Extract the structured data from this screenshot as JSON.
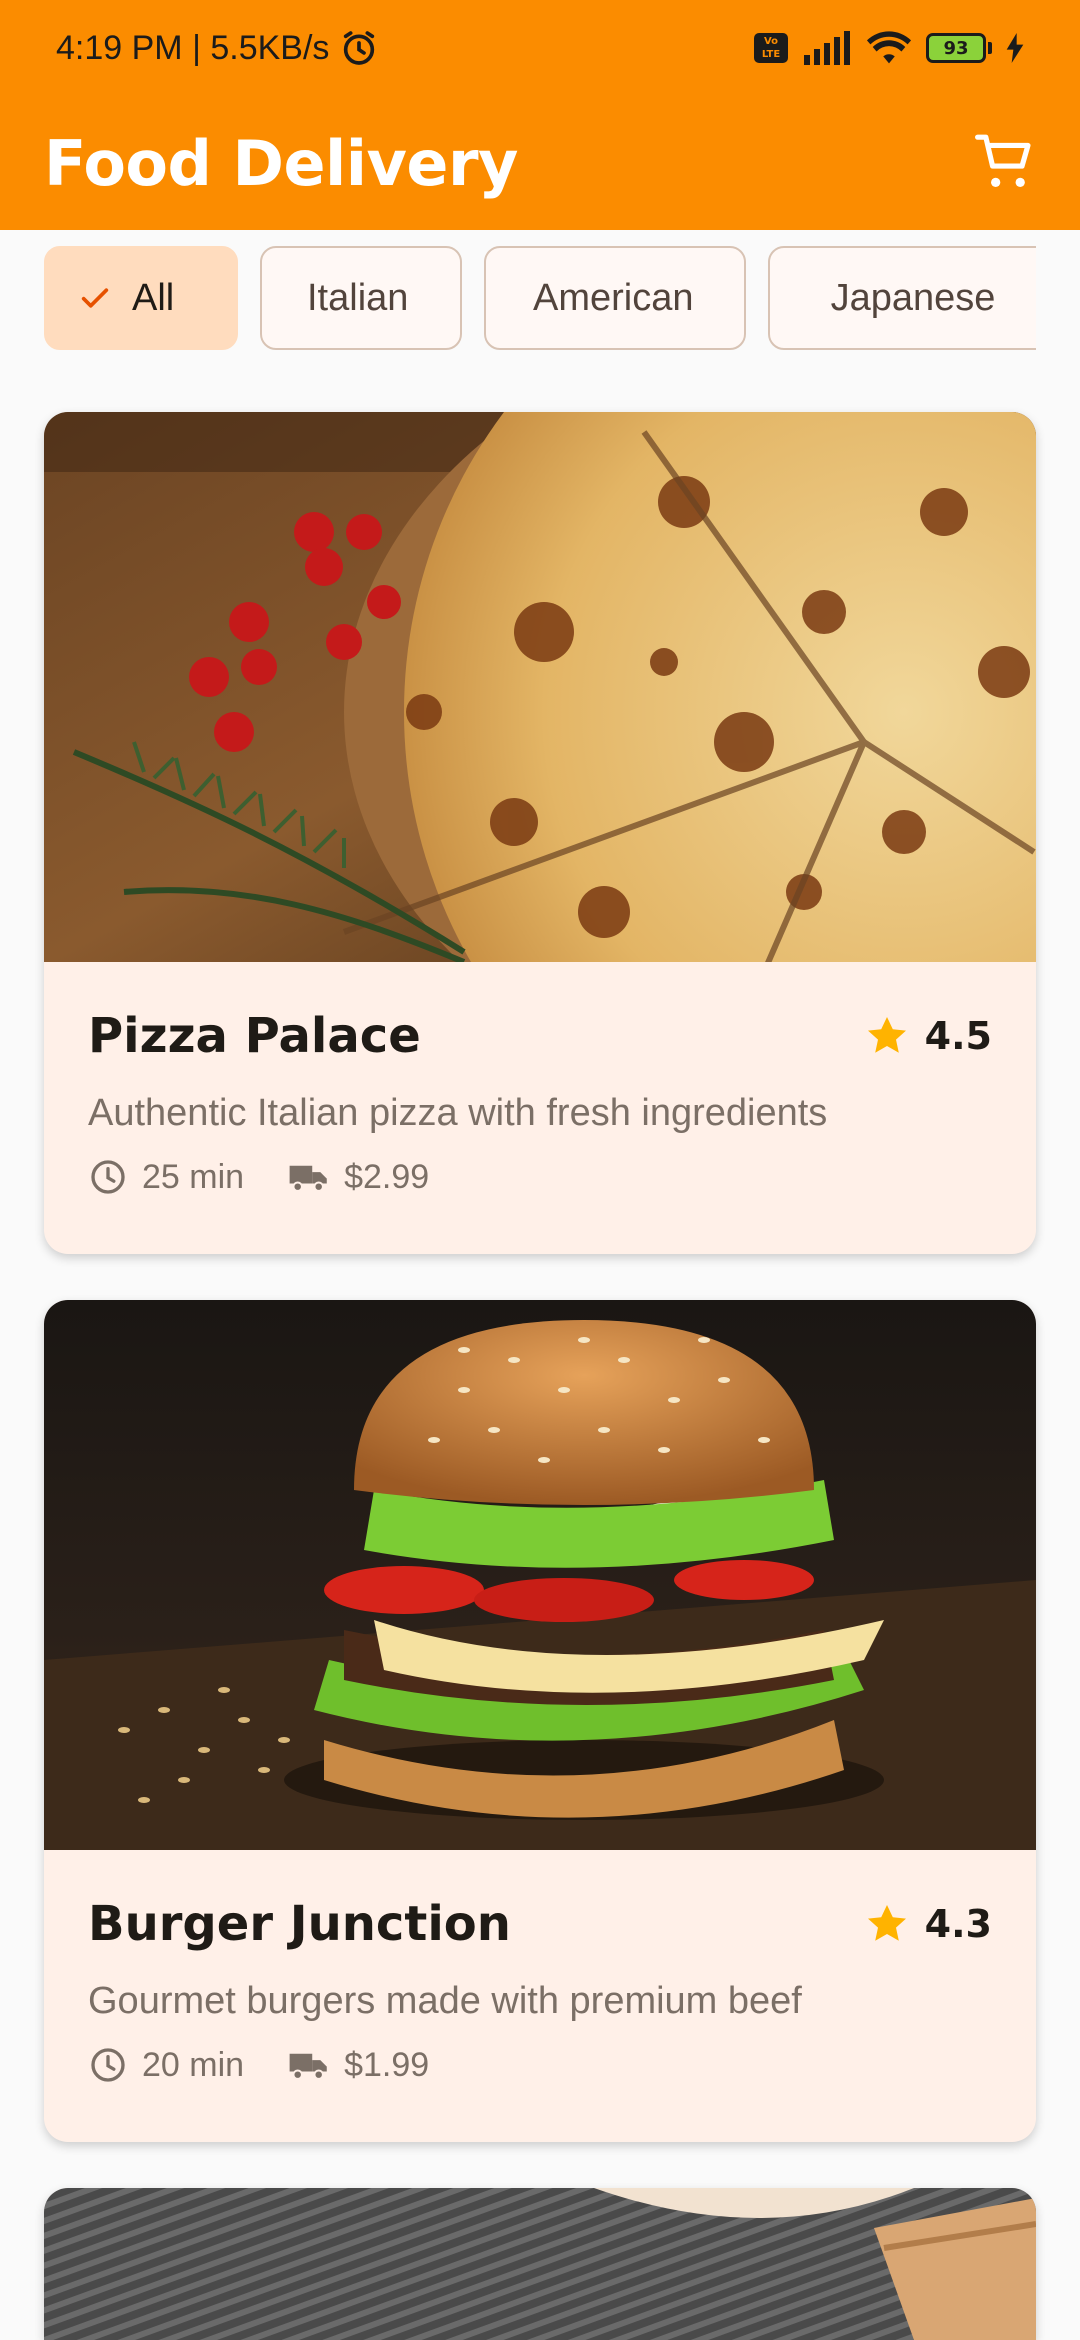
{
  "status_bar": {
    "time_speed": "4:19 PM | 5.5KB/s",
    "volte": "Vo LTE",
    "battery": "93"
  },
  "app_bar": {
    "title": "Food Delivery",
    "cart_icon": "shopping-cart-icon"
  },
  "filters": [
    {
      "label": "All",
      "selected": true
    },
    {
      "label": "Italian",
      "selected": false
    },
    {
      "label": "American",
      "selected": false
    },
    {
      "label": "Japanese",
      "selected": false
    }
  ],
  "restaurants": [
    {
      "name": "Pizza Palace",
      "rating": "4.5",
      "description": "Authentic Italian pizza with fresh ingredients",
      "time": "25 min",
      "fee": "$2.99"
    },
    {
      "name": "Burger Junction",
      "rating": "4.3",
      "description": "Gourmet burgers made with premium beef",
      "time": "20 min",
      "fee": "$1.99"
    }
  ],
  "colors": {
    "primary": "#fb8c00",
    "chip_selected": "#ffdcbe",
    "card_bg": "#fff0e8",
    "star": "#ffb300"
  }
}
